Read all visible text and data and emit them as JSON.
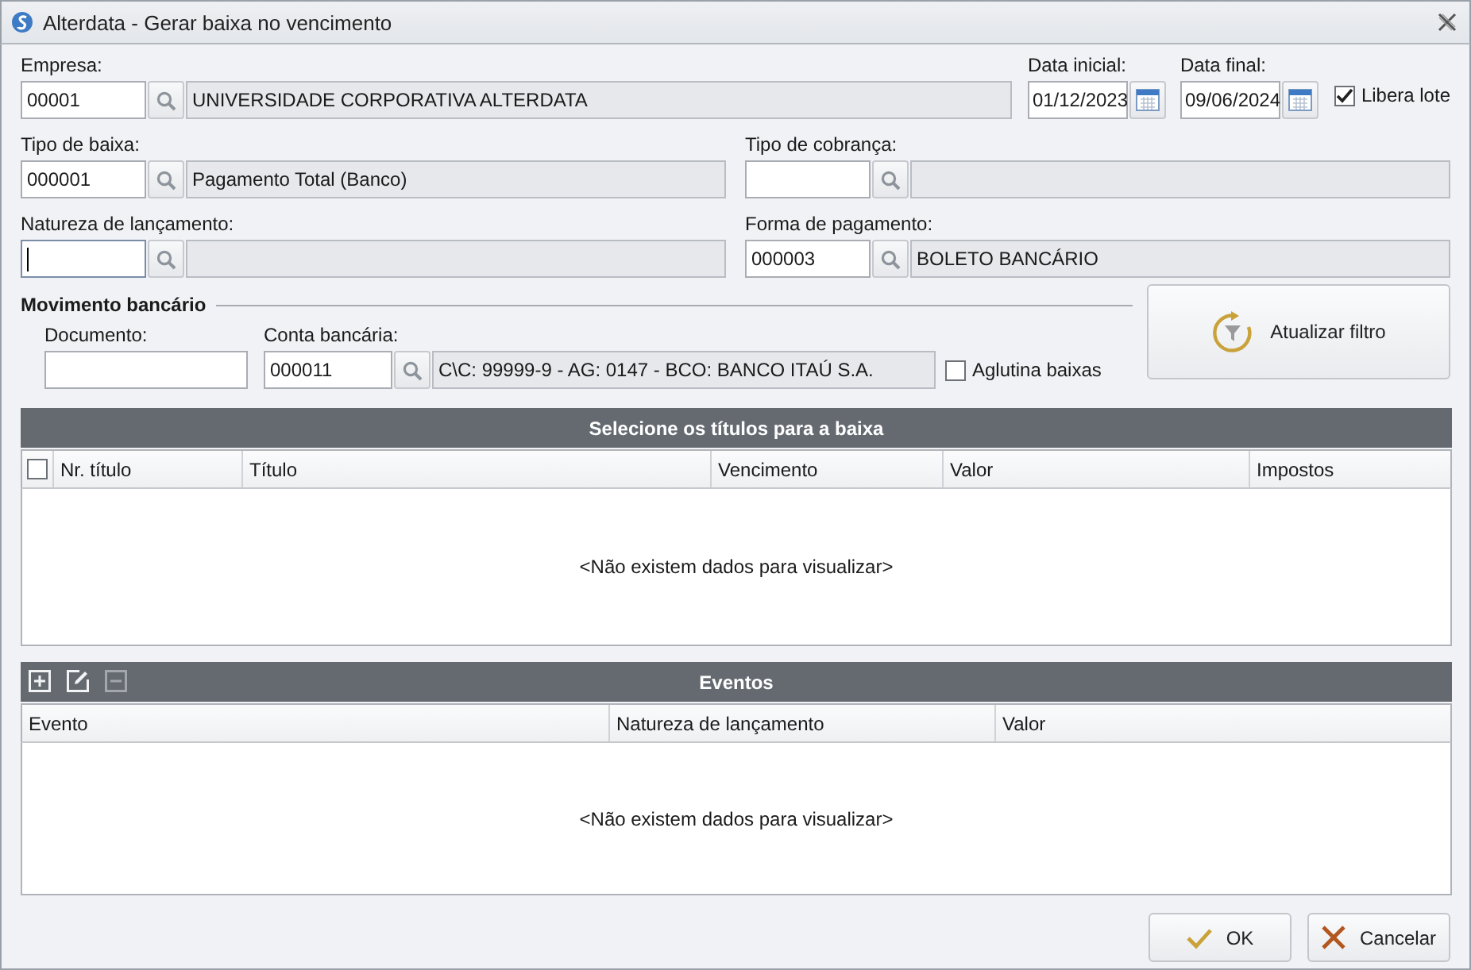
{
  "window": {
    "title": "Alterdata - Gerar baixa no vencimento"
  },
  "empresa": {
    "label": "Empresa:",
    "code": "00001",
    "description": "UNIVERSIDADE CORPORATIVA ALTERDATA"
  },
  "data_inicial": {
    "label": "Data inicial:",
    "value": "01/12/2023"
  },
  "data_final": {
    "label": "Data final:",
    "value": "09/06/2024"
  },
  "libera_lote": {
    "label": "Libera lote",
    "checked": true
  },
  "lookups": [
    {
      "label": "Tipo de baixa:",
      "code": "000001",
      "description": "Pagamento Total (Banco)",
      "focused": false
    },
    {
      "label": "Tipo de cobrança:",
      "focused": false
    },
    {
      "label": "Natureza de lançamento:",
      "focused": true
    },
    {
      "label": "Forma de pagamento:",
      "code": "000003",
      "description": "BOLETO BANCÁRIO",
      "focused": false
    }
  ],
  "movimento_bancario": {
    "title": "Movimento bancário",
    "documento": {
      "label": "Documento:"
    },
    "conta": {
      "label": "Conta bancária:",
      "code": "000011",
      "description": "C\\C: 99999-9 - AG: 0147 - BCO: BANCO ITAÚ S.A."
    },
    "aglutina": {
      "label": "Aglutina baixas",
      "checked": false
    }
  },
  "filter_button": {
    "label": "Atualizar filtro"
  },
  "titles_grid": {
    "title": "Selecione os títulos para a baixa",
    "select_all_checked": false,
    "columns": [
      "Nr. título",
      "Título",
      "Vencimento",
      "Valor",
      "Impostos"
    ],
    "empty_message": "<Não existem dados para visualizar>"
  },
  "events_grid": {
    "title": "Eventos",
    "toolbar": [
      {
        "kind": "add",
        "disabled": false
      },
      {
        "kind": "edit",
        "disabled": false
      },
      {
        "kind": "remove",
        "disabled": true
      }
    ],
    "columns": [
      "Evento",
      "Natureza de lançamento",
      "Valor"
    ],
    "empty_message": "<Não existem dados para visualizar>"
  },
  "buttons": [
    {
      "label": "OK",
      "kind": "ok"
    },
    {
      "label": "Cancelar",
      "kind": "cancel"
    }
  ]
}
